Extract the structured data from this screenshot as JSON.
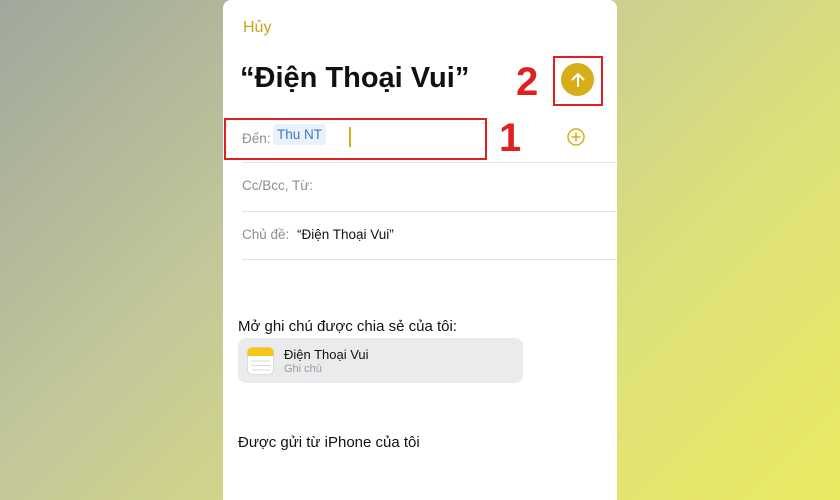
{
  "compose": {
    "cancel_label": "Hủy",
    "title": "“Điện Thoại Vui”",
    "to_label": "Đến:",
    "to_recipient": "Thu NT",
    "cc_label": "Cc/Bcc, Từ:",
    "subject_label": "Chủ đề:",
    "subject_value": "“Điện Thoại Vui”",
    "send_icon": "arrow-up-icon",
    "add_icon": "plus-circle-icon"
  },
  "body": {
    "share_text": "Mở ghi chú được chia sẻ của tôi:",
    "note_card": {
      "title": "Điện Thoại Vui",
      "subtitle": "Ghi chú",
      "icon": "notes-app-icon"
    },
    "signature": "Được gửi từ iPhone của tôi"
  },
  "annotations": {
    "step1": "1",
    "step2": "2"
  },
  "colors": {
    "accent": "#d5ae18",
    "annotation": "#e02020",
    "recipient": "#3a79c6"
  }
}
